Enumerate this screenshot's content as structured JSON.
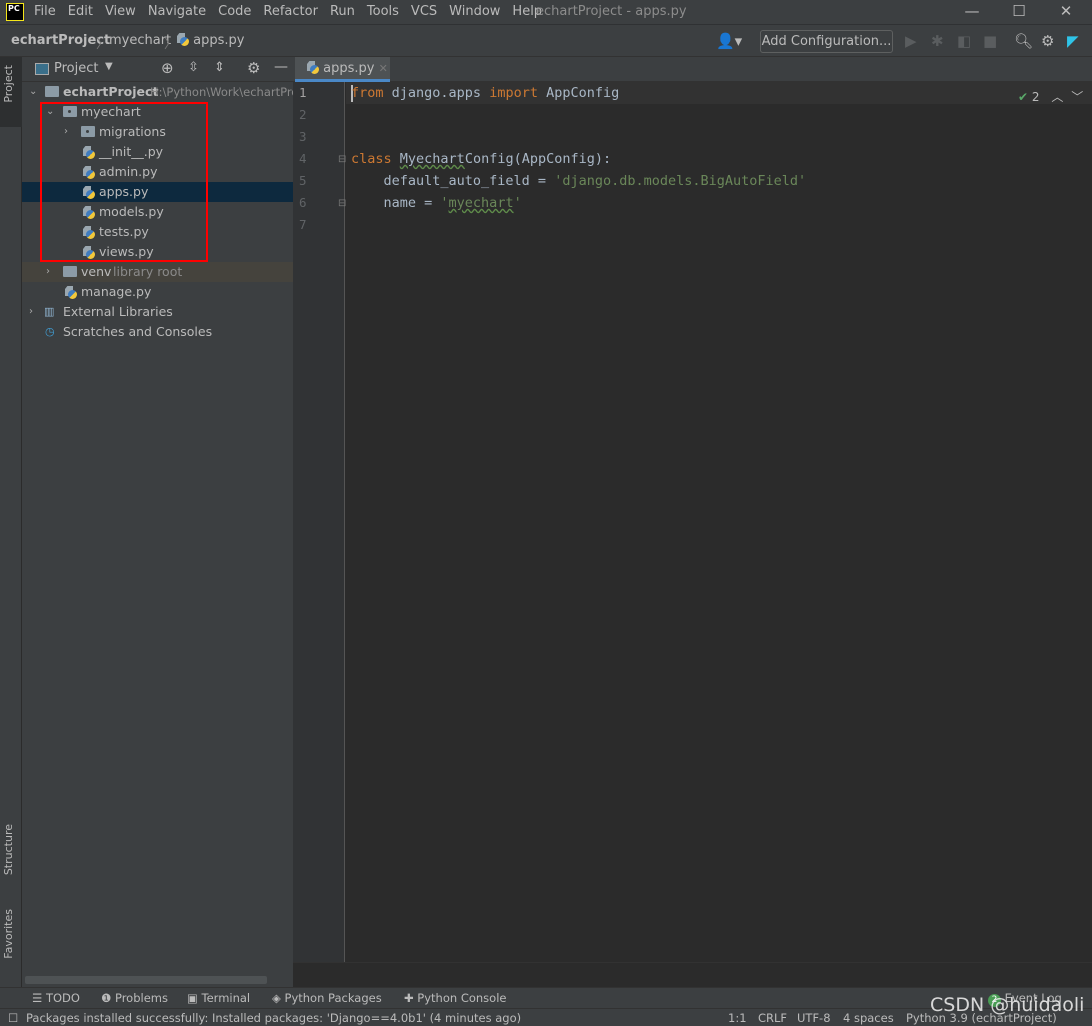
{
  "window": {
    "title": "echartProject - apps.py",
    "logo": "PC"
  },
  "menu": [
    "File",
    "Edit",
    "View",
    "Navigate",
    "Code",
    "Refactor",
    "Run",
    "Tools",
    "VCS",
    "Window",
    "Help"
  ],
  "breadcrumb": [
    "echartProject",
    "myechart",
    "apps.py"
  ],
  "toolbar": {
    "add_configuration": "Add Configuration..."
  },
  "stripe": {
    "project": "Project",
    "structure": "Structure",
    "favorites": "Favorites"
  },
  "project_panel": {
    "title": "Project",
    "tree": [
      {
        "label": "echartProject",
        "hint": "H:\\Python\\Work\\echartPro",
        "type": "folder",
        "expanded": true
      },
      {
        "label": "myechart",
        "type": "package",
        "expanded": true
      },
      {
        "label": "migrations",
        "type": "package",
        "expanded": false
      },
      {
        "label": "__init__.py",
        "type": "python"
      },
      {
        "label": "admin.py",
        "type": "python"
      },
      {
        "label": "apps.py",
        "type": "python",
        "selected": true
      },
      {
        "label": "models.py",
        "type": "python"
      },
      {
        "label": "tests.py",
        "type": "python"
      },
      {
        "label": "views.py",
        "type": "python"
      },
      {
        "label": "venv",
        "hint": "library root",
        "type": "folder",
        "expanded": false
      },
      {
        "label": "manage.py",
        "type": "python"
      },
      {
        "label": "External Libraries",
        "type": "library",
        "expanded": false
      },
      {
        "label": "Scratches and Consoles",
        "type": "scratch"
      }
    ]
  },
  "editor": {
    "tab": "apps.py",
    "inspection_count": "2",
    "line_numbers": [
      "1",
      "2",
      "3",
      "4",
      "5",
      "6",
      "7"
    ]
  },
  "bottom_tools": [
    "TODO",
    "Problems",
    "Terminal",
    "Python Packages",
    "Python Console"
  ],
  "event_log": {
    "label": "Event Log",
    "count": "2"
  },
  "status": {
    "message": "Packages installed successfully: Installed packages: 'Django==4.0b1' (4 minutes ago)",
    "position": "1:1",
    "line_sep": "CRLF",
    "encoding": "UTF-8",
    "indent": "4 spaces",
    "interpreter": "Python 3.9 (echartProject)"
  },
  "watermark": "CSDN @huidaoli"
}
